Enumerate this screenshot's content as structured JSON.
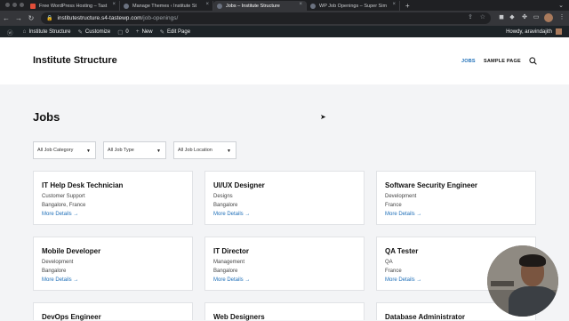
{
  "browser": {
    "tabs": [
      {
        "title": "Free WordPress Hosting – Tast",
        "active": false
      },
      {
        "title": "Manage Themes ‹ Institute St",
        "active": false
      },
      {
        "title": "Jobs – Institute Structure",
        "active": true
      },
      {
        "title": "WP Job Openings – Super Sim",
        "active": false
      }
    ],
    "url_host": "institutestructure.s4-tastewp.com",
    "url_path": "/job-openings/"
  },
  "adminbar": {
    "site": "Institute Structure",
    "customize": "Customize",
    "comments": "0",
    "new": "New",
    "edit": "Edit Page",
    "howdy": "Howdy, aravindajith"
  },
  "site": {
    "title": "Institute Structure",
    "nav": [
      "JOBS",
      "SAMPLE PAGE"
    ]
  },
  "page": {
    "title": "Jobs",
    "filters": [
      "All Job Category",
      "All Job Type",
      "All Job Location"
    ],
    "more_label": "More Details →",
    "jobs": [
      {
        "title": "IT Help Desk Technician",
        "category": "Customer Support",
        "location": "Bangalore, France"
      },
      {
        "title": "UI/UX Designer",
        "category": "Designs",
        "location": "Bangalore"
      },
      {
        "title": "Software Security Engineer",
        "category": "Development",
        "location": "France"
      },
      {
        "title": "Mobile Developer",
        "category": "Development",
        "location": "Bangalore"
      },
      {
        "title": "IT Director",
        "category": "Management",
        "location": "Bangalore"
      },
      {
        "title": "QA Tester",
        "category": "QA",
        "location": "France"
      },
      {
        "title": "DevOps Engineer",
        "category": "",
        "location": ""
      },
      {
        "title": "Web Designers",
        "category": "",
        "location": ""
      },
      {
        "title": "Database Administrator",
        "category": "",
        "location": ""
      }
    ]
  },
  "colors": {
    "accent": "#1e6fb8",
    "adminbar": "#1d2327",
    "background": "#f3f4f6"
  }
}
